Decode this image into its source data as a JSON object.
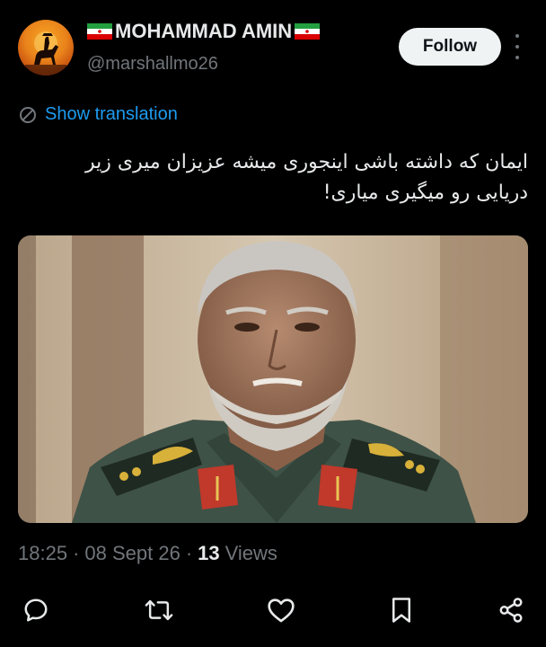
{
  "author": {
    "name": "MOHAMMAD AMIN",
    "handle": "@marshallmo26",
    "avatar_icon": "horse-rider-sunset-avatar",
    "flag_icon": "iran-flag-emoji"
  },
  "header": {
    "follow_label": "Follow",
    "more_icon": "more-vertical-icon"
  },
  "translation": {
    "label": "Show translation",
    "icon": "translate-icon"
  },
  "tweet": {
    "text": "ایمان که داشته باشی اینجوری میشه عزیزان میری زیر دریایی رو میگیری میاری!"
  },
  "media": {
    "description_icon": "photo-man-in-military-uniform"
  },
  "meta": {
    "time": "18:25",
    "separator": "·",
    "date": "08 Sept 26",
    "views_count": "13",
    "views_label": "Views"
  },
  "actions": {
    "reply_icon": "reply-icon",
    "retweet_icon": "retweet-icon",
    "like_icon": "like-icon",
    "bookmark_icon": "bookmark-icon",
    "share_icon": "share-icon"
  },
  "colors": {
    "background": "#000000",
    "text": "#e7e9ea",
    "secondary": "#71767b",
    "link": "#1d9bf0",
    "follow_bg": "#eff3f4"
  }
}
